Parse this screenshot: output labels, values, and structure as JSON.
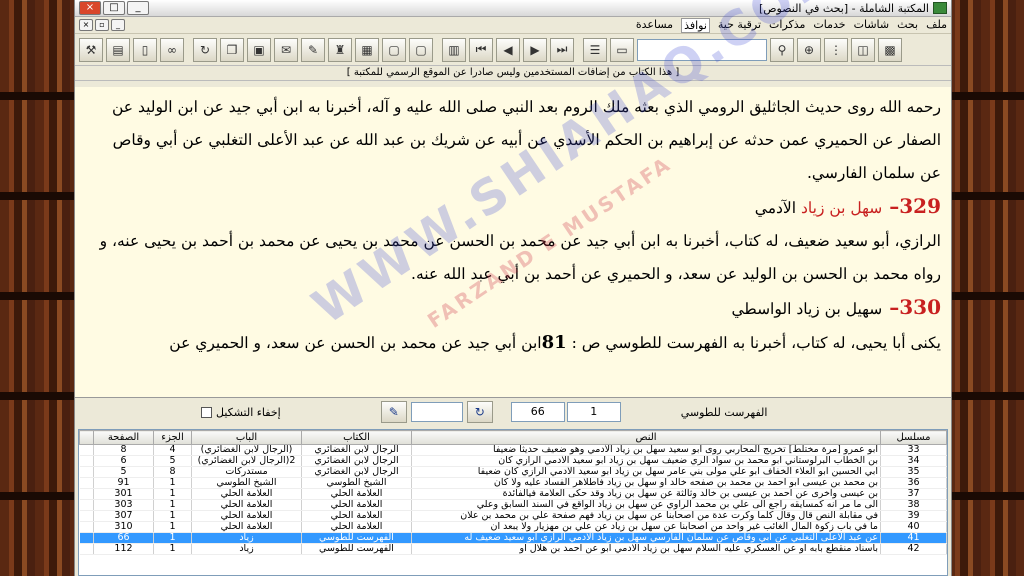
{
  "window": {
    "title": "المكتبة الشاملة - [بحث في النصوص]",
    "min": "_",
    "max": "□",
    "close": "×"
  },
  "menu": {
    "items": [
      "ملف",
      "بحث",
      "شاشات",
      "خدمات",
      "مذكرات",
      "ترقية حية",
      "نوافذ",
      "مساعدة"
    ],
    "active_index": 6
  },
  "toolbar": {
    "icons": [
      "hammer-icon",
      "book-settings-icon",
      "page-icon",
      "binoculars-icon",
      "refresh-icon",
      "copy-icon",
      "clipboard-icon",
      "note-icon",
      "pen-icon",
      "stamp-icon",
      "grid-icon",
      "blank-icon",
      "blank-icon",
      "book-icon",
      "first-icon",
      "prev-icon",
      "next-icon",
      "last-icon",
      "library-icon",
      "folder-icon",
      "search-icon",
      "zoom-icon",
      "tree-icon",
      "open-book-icon",
      "books-icon"
    ],
    "search_value": ""
  },
  "notice": "[ هذا الكتاب من إضافات المستخدمين وليس صادرا عن الموقع الرسمي للمكتبة ]",
  "text": {
    "p1": "رحمه الله روى حديث الجاثليق الرومي الذي بعثه ملك الروم بعد النبي صلى الله عليه و آله، أخبرنا به ابن أبي جيد عن ابن الوليد عن الصفار عن الحميري عمن حدثه عن إبراهيم بن الحكم الأسدي عن أبيه عن شريك بن عبد الله عن عبد الأعلى التغلبي عن أبي وقاص عن سلمان الفارسي.",
    "h1_num": "329",
    "h1_name": "سهل بن زياد",
    "h1_rest": "الآدمي",
    "p2": "الرازي، أبو سعيد ضعيف، له كتاب، أخبرنا به ابن أبي جيد عن محمد بن الحسن عن محمد بن يحيى عن محمد بن أحمد بن يحيى عنه، و رواه محمد بن الحسن بن الوليد عن سعد، و الحميري عن أحمد بن أبي عبد الله عنه.",
    "h2_num": "330",
    "h2_rest": "سهيل بن زياد الواسطي",
    "p3_a": "يكنى أبا يحيى، له كتاب، أخبرنا به الفهرست للطوسي ص : ",
    "p3_page": "81",
    "p3_b": "ابن أبي جيد عن محمد بن الحسن عن سعد، و الحميري عن"
  },
  "watermark": {
    "main": "WWW.SHIAHAQ.COM",
    "sub": "FARZAND E MUSTAFA"
  },
  "nav": {
    "hide_diacritics_label": "إخفاء التشكيل",
    "field_empty": "",
    "page": "66",
    "part": "1",
    "book_name": "الفهرست للطوسي"
  },
  "table": {
    "headers": [
      "مسلسل",
      "النص",
      "الكتاب",
      "الباب",
      "الجزء",
      "الصفحة"
    ],
    "rows": [
      {
        "n": "33",
        "text": "أبو عمرو [مرة مختلط] تخريج المحاربي روى أبو سعيد سهل بن زياد الآدمي وهو ضعيف حديثا ضعيفا",
        "book": "الرجال لابن الغضائري",
        "bab": "(الرجال لابن الغضائري)",
        "juz": "4",
        "page": "8",
        "sel": false
      },
      {
        "n": "34",
        "text": "بن الخطاب البرلوستاني أبو محمد بن سواد الري ضعيف سهل بن زياد أبو سعيد الآدمي الرازي كان",
        "book": "الرجال لابن الغضائري",
        "bab": "(الرجال لابن الغضائري)2",
        "juz": "5",
        "page": "6",
        "sel": false
      },
      {
        "n": "35",
        "text": "أبي الحسين أبو العلاء الخفاف أبو علي مولى بني عامر سهل بن زياد أبو سعيد الآدمي الرازي كان ضعيفا",
        "book": "الرجال لابن الغضائري",
        "bab": "مستدركات",
        "juz": "8",
        "page": "5",
        "sel": false
      },
      {
        "n": "36",
        "text": "بن محمد بن عيسى أبو أحمد بن محمد بن صفحه خالد أو سهل بن زياد فاطلاهر الفساد عليه ولا كان",
        "book": "الشيخ الطوسي",
        "bab": "الشيخ الطوسي",
        "juz": "1",
        "page": "91",
        "sel": false
      },
      {
        "n": "37",
        "text": "بن عيسى وأخرى عن أحمد بن عيسى بن خالد وثالثة عن سهل بن زياد وقد حكى العلامة فيالفائدة",
        "book": "العلامة الحلي",
        "bab": "العلامة الحلي",
        "juz": "1",
        "page": "301",
        "sel": false
      },
      {
        "n": "38",
        "text": "الى ما مر أنه كمسايقه راجع الى علي بن محمد الراوي عن سهل بن زياد الواقع في السند السابق وعلي",
        "book": "العلامة الحلي",
        "bab": "العلامة الحلي",
        "juz": "1",
        "page": "303",
        "sel": false
      },
      {
        "n": "39",
        "text": "في مقابلة النص قال وقال كلما وكرت عدة من أصحابنا عن سهل بن زياد فهم صفحة علي بن محمد بن علان",
        "book": "العلامة الحلي",
        "bab": "العلامة الحلي",
        "juz": "1",
        "page": "307",
        "sel": false
      },
      {
        "n": "40",
        "text": "ما في باب زكوة المال الغائب غير واحد من أصحابنا عن سهل بن زياد عن علي بن مهزيار ولا يبعد أن",
        "book": "العلامة الحلي",
        "bab": "العلامة الحلي",
        "juz": "1",
        "page": "310",
        "sel": false
      },
      {
        "n": "41",
        "text": "عن عبد الأعلى التغلبي عن أبي وقاص عن سلمان الفارسي سهل بن زياد الآدمي الرازي أبو سعيد ضعيف له",
        "book": "الفهرست للطوسي",
        "bab": "زياد",
        "juz": "1",
        "page": "66",
        "sel": true
      },
      {
        "n": "42",
        "text": "باسناد منقطع بابه أو عن العسكري عليه السلام سهل بن زياد الآدمي أبو عن أحمد بن هلال أو",
        "book": "الفهرست للطوسي",
        "bab": "زياد",
        "juz": "1",
        "page": "112",
        "sel": false
      }
    ]
  }
}
